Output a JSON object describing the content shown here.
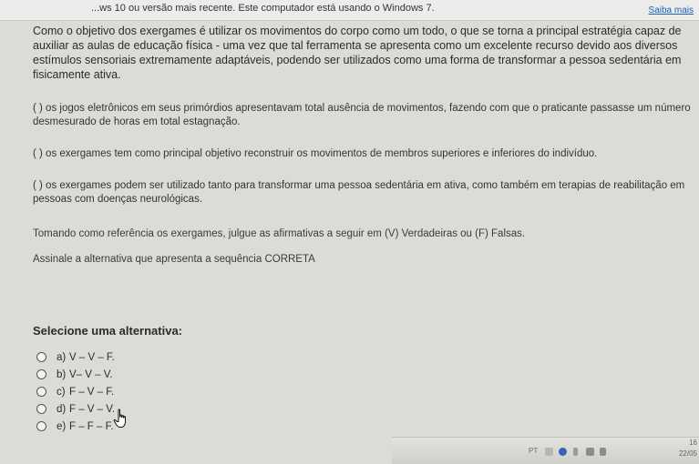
{
  "banner": {
    "text": "...ws 10 ou versão mais recente. Este computador está usando o Windows 7.",
    "link": "Saiba mais"
  },
  "question": {
    "intro": "Como o objetivo dos exergames é utilizar os movimentos do corpo como um todo, o que se torna a principal estratégia capaz de auxiliar as aulas de educação física - uma vez que tal ferramenta se apresenta como um excelente recurso devido aos diversos estímulos sensoriais extremamente adaptáveis, podendo ser utilizados como uma forma de transformar a pessoa sedentária em fisicamente ativa.",
    "statements": [
      "( ) os jogos eletrônicos em seus primórdios apresentavam total ausência de movimentos, fazendo com que o praticante passasse um número desmesurado de horas em total estagnação.",
      "( ) os exergames tem como principal objetivo reconstruir os movimentos de membros superiores e inferiores do indivíduo.",
      "( ) os exergames podem ser utilizado tanto para transformar uma pessoa sedentária em ativa, como também em terapias de reabilitação em pessoas com doenças neurológicas."
    ],
    "instruction": "Tomando como referência os exergames, julgue as afirmativas a seguir em (V) Verdadeiras ou (F) Falsas.",
    "prompt": "Assinale a alternativa que apresenta a sequência CORRETA"
  },
  "select_title": "Selecione uma alternativa:",
  "options": [
    {
      "letter": "a)",
      "text": "V – V – F."
    },
    {
      "letter": "b)",
      "text": "V– V – V."
    },
    {
      "letter": "c)",
      "text": "F – V – F."
    },
    {
      "letter": "d)",
      "text": "F – V – V."
    },
    {
      "letter": "e)",
      "text": "F – F – F."
    }
  ],
  "taskbar": {
    "language": "PT",
    "time": "16",
    "date": "22/05"
  },
  "icons": {
    "cursor": "hand-pointer-icon",
    "help": "help-icon",
    "network": "network-icon",
    "volume": "volume-icon",
    "flag": "flag-icon"
  }
}
